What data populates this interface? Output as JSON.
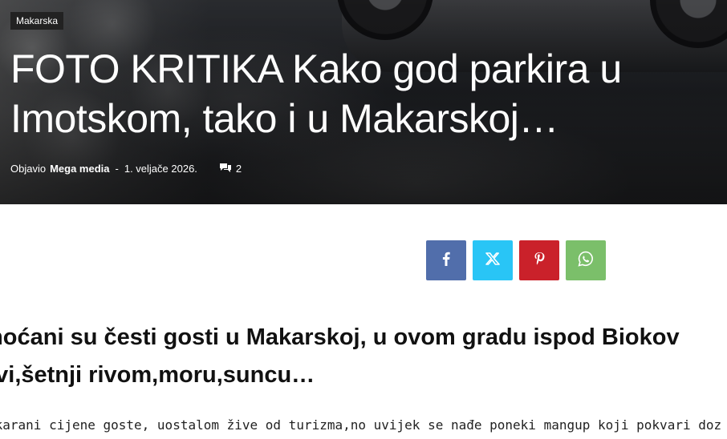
{
  "article": {
    "category": "Makarska",
    "title": "FOTO KRITIKA Kako god parkira u Imotskom, tako i u Makarskoj…",
    "meta": {
      "posted_by_label": "Objavio",
      "author": "Mega media",
      "separator": "-",
      "date": "1. veljače 2026.",
      "comment_count": "2",
      "comment_icon": "comments-icon"
    },
    "share_buttons": [
      {
        "network": "facebook",
        "icon": "facebook-icon",
        "color": "#516eab"
      },
      {
        "network": "x",
        "icon": "x-icon",
        "color": "#29c5f6"
      },
      {
        "network": "pinterest",
        "icon": "pinterest-icon",
        "color": "#ca212a"
      },
      {
        "network": "whatsapp",
        "icon": "whatsapp-icon",
        "color": "#7bbf6a"
      }
    ],
    "lead": {
      "line1": "moćani su česti gosti u Makarskoj, u ovom gradu ispod Biokov",
      "line2": "avi,šetnji rivom,moru,suncu…"
    },
    "body_first_line": "akarani cijene goste, uostalom žive od turizma,no uvijek se nađe poneki mangup koji pokvari doz"
  }
}
